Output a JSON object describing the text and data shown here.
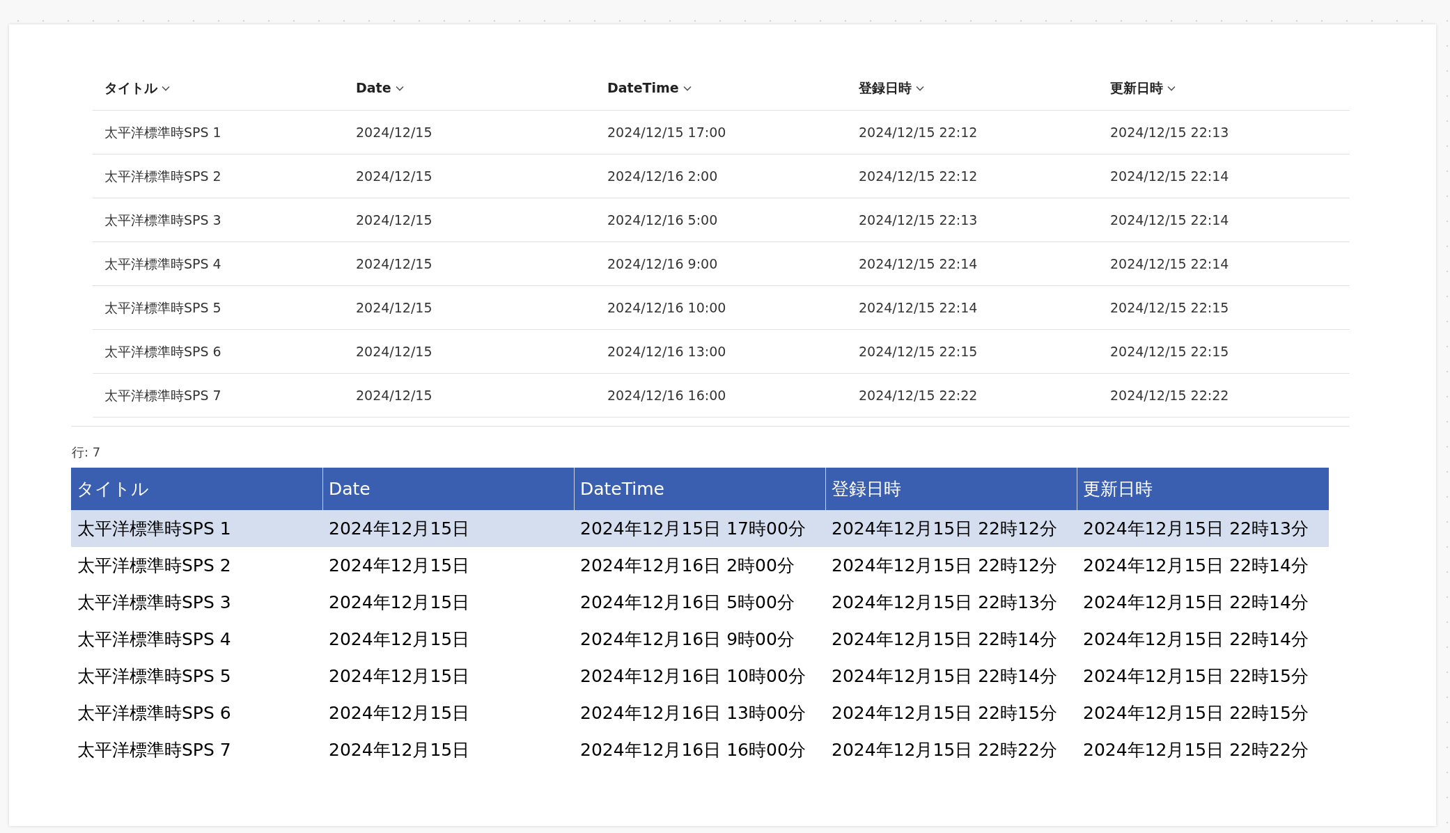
{
  "list": {
    "columns": [
      "タイトル",
      "Date",
      "DateTime",
      "登録日時",
      "更新日時"
    ],
    "rows": [
      [
        "太平洋標準時SPS 1",
        "2024/12/15",
        "2024/12/15 17:00",
        "2024/12/15 22:12",
        "2024/12/15 22:13"
      ],
      [
        "太平洋標準時SPS 2",
        "2024/12/15",
        "2024/12/16 2:00",
        "2024/12/15 22:12",
        "2024/12/15 22:14"
      ],
      [
        "太平洋標準時SPS 3",
        "2024/12/15",
        "2024/12/16 5:00",
        "2024/12/15 22:13",
        "2024/12/15 22:14"
      ],
      [
        "太平洋標準時SPS 4",
        "2024/12/15",
        "2024/12/16 9:00",
        "2024/12/15 22:14",
        "2024/12/15 22:14"
      ],
      [
        "太平洋標準時SPS 5",
        "2024/12/15",
        "2024/12/16 10:00",
        "2024/12/15 22:14",
        "2024/12/15 22:15"
      ],
      [
        "太平洋標準時SPS 6",
        "2024/12/15",
        "2024/12/16 13:00",
        "2024/12/15 22:15",
        "2024/12/15 22:15"
      ],
      [
        "太平洋標準時SPS 7",
        "2024/12/15",
        "2024/12/16 16:00",
        "2024/12/15 22:22",
        "2024/12/15 22:22"
      ]
    ],
    "row_count": "行: 7"
  },
  "grid": {
    "columns": [
      "タイトル",
      "Date",
      "DateTime",
      "登録日時",
      "更新日時"
    ],
    "rows": [
      {
        "selected": true,
        "cells": [
          "太平洋標準時SPS 1",
          "2024年12月15日",
          "2024年12月15日 17時00分",
          "2024年12月15日 22時12分",
          "2024年12月15日 22時13分"
        ]
      },
      {
        "selected": false,
        "cells": [
          "太平洋標準時SPS 2",
          "2024年12月15日",
          "2024年12月16日 2時00分",
          "2024年12月15日 22時12分",
          "2024年12月15日 22時14分"
        ]
      },
      {
        "selected": false,
        "cells": [
          "太平洋標準時SPS 3",
          "2024年12月15日",
          "2024年12月16日 5時00分",
          "2024年12月15日 22時13分",
          "2024年12月15日 22時14分"
        ]
      },
      {
        "selected": false,
        "cells": [
          "太平洋標準時SPS 4",
          "2024年12月15日",
          "2024年12月16日 9時00分",
          "2024年12月15日 22時14分",
          "2024年12月15日 22時14分"
        ]
      },
      {
        "selected": false,
        "cells": [
          "太平洋標準時SPS 5",
          "2024年12月15日",
          "2024年12月16日 10時00分",
          "2024年12月15日 22時14分",
          "2024年12月15日 22時15分"
        ]
      },
      {
        "selected": false,
        "cells": [
          "太平洋標準時SPS 6",
          "2024年12月15日",
          "2024年12月16日 13時00分",
          "2024年12月15日 22時15分",
          "2024年12月15日 22時15分"
        ]
      },
      {
        "selected": false,
        "cells": [
          "太平洋標準時SPS 7",
          "2024年12月15日",
          "2024年12月16日 16時00分",
          "2024年12月15日 22時22分",
          "2024年12月15日 22時22分"
        ]
      }
    ]
  }
}
